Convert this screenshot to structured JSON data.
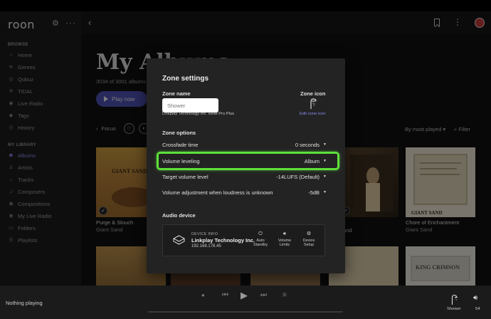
{
  "sidebar": {
    "logo": "roon",
    "browse_heading": "BROWSE",
    "browse_items": [
      {
        "label": "Home",
        "icon": "home-icon"
      },
      {
        "label": "Genres",
        "icon": "genres-icon"
      },
      {
        "label": "Qobuz",
        "icon": "qobuz-icon"
      },
      {
        "label": "TIDAL",
        "icon": "tidal-icon"
      },
      {
        "label": "Live Radio",
        "icon": "radio-icon"
      },
      {
        "label": "Tags",
        "icon": "tag-icon"
      },
      {
        "label": "History",
        "icon": "history-icon"
      }
    ],
    "library_heading": "MY LIBRARY",
    "library_items": [
      {
        "label": "Albums",
        "icon": "album-icon",
        "active": true
      },
      {
        "label": "Artists",
        "icon": "artist-icon"
      },
      {
        "label": "Tracks",
        "icon": "tracks-icon"
      },
      {
        "label": "Composers",
        "icon": "composer-icon"
      },
      {
        "label": "Compositions",
        "icon": "compositions-icon"
      },
      {
        "label": "My Live Radio",
        "icon": "radio-icon"
      },
      {
        "label": "Folders",
        "icon": "folder-icon"
      },
      {
        "label": "Playlists",
        "icon": "playlist-icon"
      }
    ]
  },
  "main": {
    "title": "My Albums",
    "subtitle": "3034 of 3001 albums",
    "play_now": "Play now",
    "focus": "Focus",
    "sort": "By most played",
    "filter": "Filter",
    "albums": [
      {
        "title": "Purge & Slouch",
        "artist": "Giant Sand"
      },
      {
        "title": "",
        "artist": ""
      },
      {
        "title": "",
        "artist": ""
      },
      {
        "title": "",
        "artist": ""
      },
      {
        "title": "Chore of Enchantment",
        "artist": "Giant Sand"
      }
    ],
    "partial_album_title": "and",
    "partial_album_artist": "Sand"
  },
  "zone_settings": {
    "title": "Zone settings",
    "zone_name_label": "Zone name",
    "zone_name_placeholder": "Shower",
    "device_line": "Linkplay Technology Inc. WiiM Pro Plus",
    "zone_icon_label": "Zone icon",
    "edit_zone_icon": "Edit zone icon",
    "zone_options_label": "Zone options",
    "options": [
      {
        "label": "Crossfade time",
        "value": "0 seconds"
      },
      {
        "label": "Volume leveling",
        "value": "Album"
      },
      {
        "label": "Target volume level",
        "value": "-14LUFS (Default)"
      },
      {
        "label": "Volume adjustment when loudness is unknown",
        "value": "-5dB"
      }
    ],
    "audio_device_label": "Audio device",
    "device_info_label": "DEVICE INFO",
    "device_name": "Linkplay Technology Inc.",
    "device_ip": "192.168.178.45",
    "actions": [
      {
        "line1": "Auto",
        "line2": "Standby",
        "icon": "power-icon"
      },
      {
        "line1": "Volume",
        "line2": "Limits",
        "icon": "volume-icon"
      },
      {
        "line1": "Device",
        "line2": "Setup",
        "icon": "gear-icon"
      }
    ],
    "highlight_color": "#5ee03a"
  },
  "footer": {
    "now_playing": "Nothing playing",
    "zone_label": "Shower",
    "volume": "54"
  },
  "colors": {
    "accent": "#8b8bf0",
    "play_button": "#4e4fb0"
  }
}
